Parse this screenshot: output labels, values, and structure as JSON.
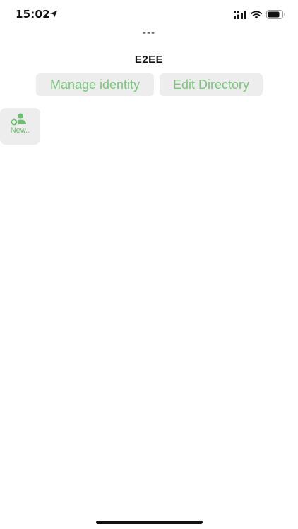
{
  "status_bar": {
    "time": "15:02",
    "location_icon": "location-arrow-icon",
    "signal_icon": "cellular-signal-icon",
    "wifi_icon": "wifi-icon",
    "battery_icon": "battery-icon"
  },
  "header": {
    "subtitle": "---",
    "title": "E2EE"
  },
  "actions": {
    "manage_identity": "Manage identity",
    "edit_directory": "Edit Directory"
  },
  "contacts": {
    "new_label": "New..",
    "new_icon": "add-person-icon"
  },
  "colors": {
    "accent": "#7cc47f",
    "button_bg": "#ededed",
    "background": "#ffffff"
  }
}
